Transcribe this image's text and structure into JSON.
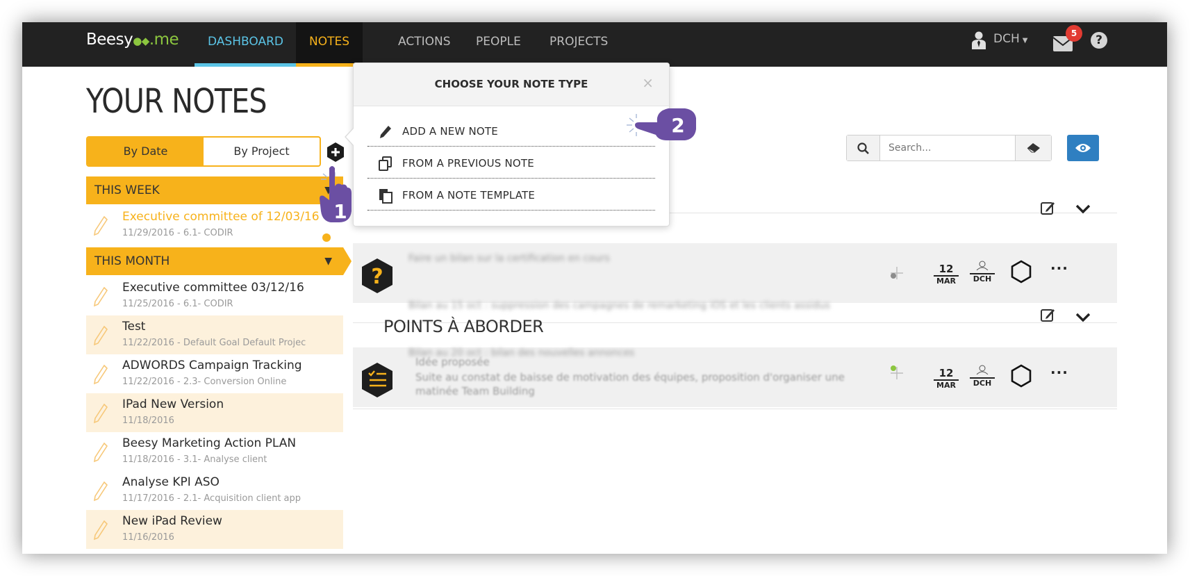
{
  "app": {
    "logo": "Beesy",
    "logo_suffix": ".me"
  },
  "nav": {
    "items": [
      "DASHBOARD",
      "NOTES",
      "ACTIONS",
      "PEOPLE",
      "PROJECTS"
    ],
    "active": "NOTES",
    "user": "DCH",
    "mail_count": "5",
    "help": "?"
  },
  "colors": {
    "accent": "#f7b21b",
    "dashboard": "#5bc4e6",
    "topbar": "#222222",
    "badge": "#e23b32",
    "eye_button": "#2f7fc1",
    "tutorial": "#6b4fa3"
  },
  "sidebar": {
    "title": "YOUR NOTES",
    "toggle": {
      "by_date": "By Date",
      "by_project": "By Project"
    },
    "sections": [
      {
        "label": "THIS WEEK",
        "notes": [
          {
            "title": "Executive committee of 12/03/16",
            "meta": "11/29/2016  -  6.1- CODIR"
          }
        ]
      },
      {
        "label": "THIS MONTH",
        "notes": [
          {
            "title": "Executive committee 03/12/16",
            "meta": "11/25/2016  -  6.1- CODIR"
          },
          {
            "title": "Test",
            "meta": "11/22/2016  -  Default Goal Default Projec"
          },
          {
            "title": "ADWORDS Campaign Tracking",
            "meta": "11/22/2016  -  2.3- Conversion Online"
          },
          {
            "title": "IPad New Version",
            "meta": "11/18/2016"
          },
          {
            "title": "Beesy Marketing Action PLAN",
            "meta": "11/18/2016  -  3.1- Analyse client"
          },
          {
            "title": "Analyse KPI ASO",
            "meta": "11/17/2016  -  2.1- Acquisition client app"
          },
          {
            "title": "New iPad Review",
            "meta": "11/16/2016"
          }
        ]
      }
    ]
  },
  "search": {
    "placeholder": "Search..."
  },
  "main": {
    "section_title": "POINTS À ABORDER",
    "rows": [
      {
        "day": "12",
        "month": "MAR",
        "who": "DCH"
      },
      {
        "day": "12",
        "month": "MAR",
        "who": "DCH"
      }
    ],
    "blurred": [
      "Faire un bilan sur la certification en cours",
      "Bilan au 15 oct : suppression des campagnes de remarketing iOS et les clients assidus",
      "Bilan au 20 oct : bilan des nouvelles annonces",
      "Idée proposée",
      "Suite au constat de baisse de motivation des équipes, proposition d'organiser une",
      "matinée Team Building"
    ]
  },
  "popup": {
    "title": "CHOOSE YOUR NOTE TYPE",
    "close": "×",
    "options": [
      "ADD A NEW NOTE",
      "FROM A PREVIOUS NOTE",
      "FROM A NOTE TEMPLATE"
    ]
  },
  "tutorial": {
    "step1": "1",
    "step2": "2"
  },
  "icons": [
    "user-icon",
    "mail-icon",
    "help-icon",
    "plus-hex-icon",
    "pencil-icon",
    "search-icon",
    "eraser-icon",
    "eye-icon",
    "question-hex-icon",
    "checklist-hex-icon",
    "edit-icon",
    "chevron-down-icon",
    "copy-icon",
    "template-icon",
    "close-icon",
    "hand-pointer-icon"
  ]
}
